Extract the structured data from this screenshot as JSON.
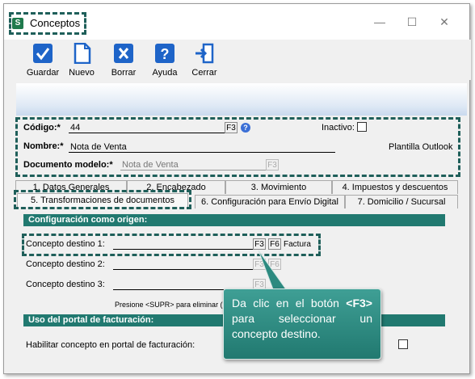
{
  "window": {
    "title": "Conceptos",
    "app_icon": "S"
  },
  "toolbar": {
    "buttons": [
      {
        "label": "Guardar",
        "icon": "checkmark-icon"
      },
      {
        "label": "Nuevo",
        "icon": "document-icon"
      },
      {
        "label": "Borrar",
        "icon": "delete-x-icon"
      },
      {
        "label": "Ayuda",
        "icon": "help-icon"
      },
      {
        "label": "Cerrar",
        "icon": "exit-door-icon"
      }
    ]
  },
  "header": {
    "codigo_label": "Código:*",
    "codigo_value": "44",
    "codigo_btn": "F3",
    "inactivo_label": "Inactivo:",
    "nombre_label": "Nombre:*",
    "nombre_value": "Nota de Venta",
    "plantilla_text": "Plantilla Outlook",
    "documento_label": "Documento modelo:*",
    "documento_value": "Nota de Venta",
    "documento_btn": "F3"
  },
  "tabs_row1": [
    "1. Datos Generales",
    "2. Encabezado",
    "3. Movimiento",
    "4. Impuestos y descuentos"
  ],
  "tabs_row2": [
    "5. Transformaciones de documentos",
    "6. Configuración para Envío Digital",
    "7. Domicilio / Sucursal"
  ],
  "origen": {
    "section_title": "Configuración como origen:",
    "rows": [
      {
        "label": "Concepto destino 1:",
        "value": "",
        "f3": "F3",
        "f6": "F6",
        "extra": "Factura"
      },
      {
        "label": "Concepto destino 2:",
        "value": "",
        "f3": "F3",
        "f6": "F6",
        "extra": ""
      },
      {
        "label": "Concepto destino 3:",
        "value": "",
        "f3": "F3",
        "f6": "",
        "extra": ""
      }
    ],
    "hint": "Presione <SUPR> para eliminar ("
  },
  "portal": {
    "section_title": "Uso del portal de facturación:",
    "habilitar_label": "Habilitar concepto en portal de facturación:"
  },
  "tooltip": {
    "pre": "Da clic en el botón ",
    "key": "<F3>",
    "post": " para seleccionar un concepto destino."
  },
  "colors": {
    "accent": "#217970",
    "dash": "#1f5f5a",
    "toolbar_icon": "#1e64c8"
  }
}
